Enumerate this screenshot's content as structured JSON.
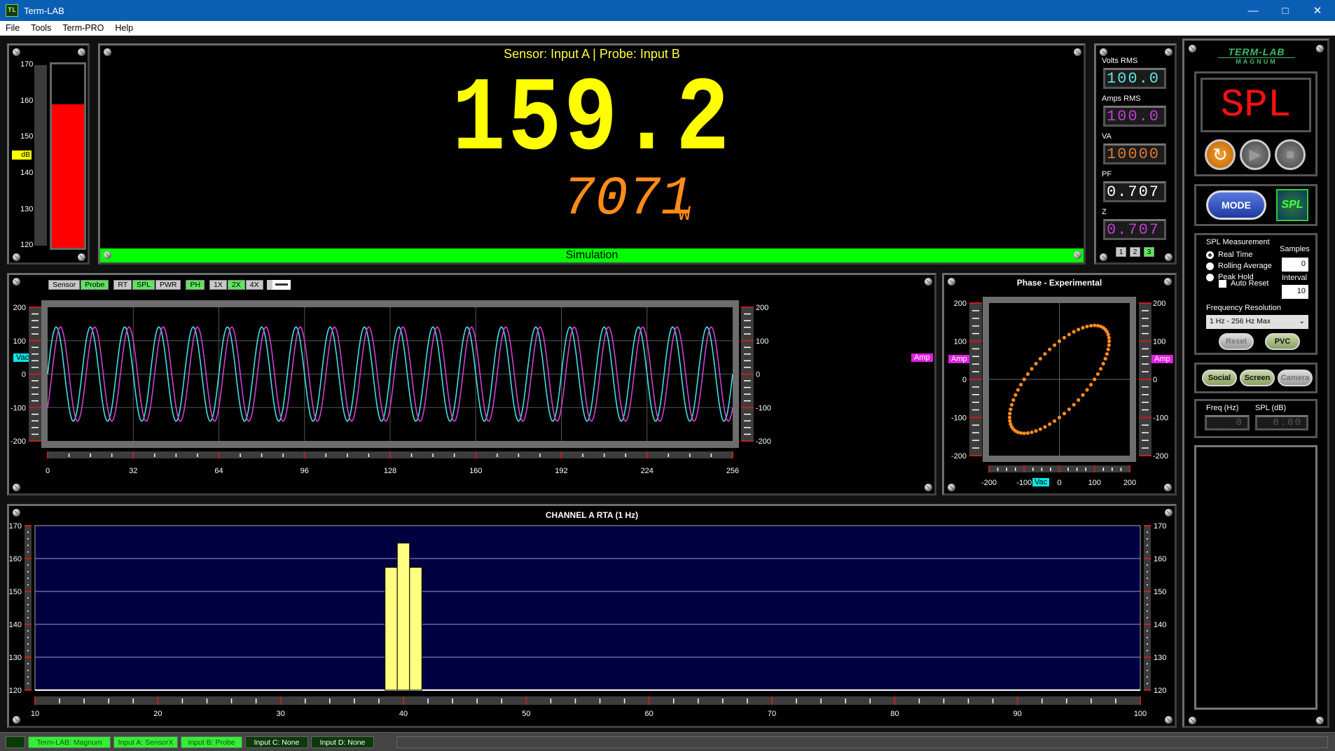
{
  "window": {
    "title": "Term-LAB",
    "icon_label": "TL",
    "minimize_icon": "minimize-icon",
    "maximize_icon": "maximize-icon",
    "close_icon": "close-icon"
  },
  "menu": [
    "File",
    "Tools",
    "Term-PRO",
    "Help"
  ],
  "spl_meter": {
    "unit_label": "dB",
    "scale_labels": [
      "170",
      "160",
      "150",
      "140",
      "130",
      "120"
    ],
    "range": [
      120,
      170
    ],
    "level": 159.2,
    "fill_color": "#ff0000"
  },
  "main_display": {
    "header": "Sensor: Input A | Probe: Input B",
    "primary_value": "159.2",
    "secondary_value": "7071",
    "secondary_unit": "W",
    "footer": "Simulation",
    "primary_color": "#ffff00",
    "secondary_color": "#ff8c1a",
    "footer_color": "#00ff00"
  },
  "readouts": {
    "items": [
      {
        "label": "Volts RMS",
        "value": "100.0",
        "color": "#5ee6e6"
      },
      {
        "label": "Amps RMS",
        "value": "100.0",
        "color": "#c040d0"
      },
      {
        "label": "VA",
        "value": "10000",
        "color": "#e07a30"
      },
      {
        "label": "PF",
        "value": "0.707",
        "color": "#ffffff"
      },
      {
        "label": "Z",
        "value": "0.707",
        "color": "#c040d0"
      }
    ],
    "pages": [
      "1",
      "2",
      "3"
    ],
    "active_page": "3"
  },
  "control_panel": {
    "logo_top": "TERM-LAB",
    "logo_bottom": "MAGNUM",
    "mode_display": "SPL",
    "transport": {
      "reset_icon": "refresh-icon",
      "play_icon": "play-icon",
      "stop_icon": "stop-icon"
    },
    "mode_button": "MODE",
    "mode_badge": "SPL",
    "spl_measurement": {
      "title": "SPL Measurement",
      "options": [
        "Real Time",
        "Rolling Average",
        "Peak Hold"
      ],
      "selected": "Real Time",
      "auto_reset_label": "Auto Reset",
      "auto_reset_checked": false,
      "samples_label": "Samples",
      "samples_value": "0",
      "interval_label": "Interval",
      "interval_value": "10",
      "freq_res_label": "Frequency Resolution",
      "freq_res_value": "1 Hz - 256 Hz Max",
      "reset_button": "Reset",
      "pvc_button": "PVC"
    },
    "share": {
      "social": "Social",
      "screen": "Screen",
      "camera": "Camera"
    },
    "cursor": {
      "freq_label": "Freq (Hz)",
      "freq_value": "0",
      "spl_label": "SPL (dB)",
      "spl_value": "0.00"
    }
  },
  "scope_toolbar": [
    "Sensor",
    "Probe",
    "RT",
    "SPL",
    "PWR",
    "PH",
    "1X",
    "2X",
    "4X"
  ],
  "scope_toolbar_active": [
    "Probe",
    "SPL",
    "PH",
    "2X"
  ],
  "status_bar": [
    {
      "label": "",
      "active": false
    },
    {
      "label": "Term-LAB: Magnum",
      "active": true
    },
    {
      "label": "Input A: SensorX",
      "active": true
    },
    {
      "label": "Input B: Probe",
      "active": true
    },
    {
      "label": "Input C: None",
      "active": false
    },
    {
      "label": "Input D: None",
      "active": false
    }
  ],
  "chart_data": [
    {
      "type": "line",
      "title": "",
      "xlabel": "",
      "ylabel_left": "Vac",
      "ylabel_right": "Amp",
      "x_range": [
        0,
        256
      ],
      "y_range": [
        -200,
        200
      ],
      "x_ticks": [
        "0",
        "32",
        "64",
        "96",
        "128",
        "160",
        "192",
        "224",
        "256"
      ],
      "y_ticks": [
        "200",
        "100",
        "0",
        "-100",
        "-200"
      ],
      "grid": true,
      "series": [
        {
          "name": "Vac",
          "color": "#40e0e0",
          "amplitude": 141.4,
          "cycles": 20,
          "phase_deg": 0
        },
        {
          "name": "Amp",
          "color": "#d040d0",
          "amplitude": 141.4,
          "cycles": 20,
          "phase_deg": -45
        }
      ]
    },
    {
      "type": "scatter",
      "title": "Phase - Experimental",
      "xlabel": "Vac",
      "ylabel": "Amp",
      "x_range": [
        -200,
        200
      ],
      "y_range": [
        -200,
        200
      ],
      "x_ticks": [
        "-200",
        "-100",
        "0",
        "100",
        "200"
      ],
      "y_ticks": [
        "200",
        "100",
        "0",
        "-100",
        "-200"
      ],
      "grid": true,
      "series": [
        {
          "name": "Lissajous",
          "color": "#ff8c1a",
          "amplitude_x": 141.4,
          "amplitude_y": 141.4,
          "phase_deg": 45,
          "points": 64
        }
      ]
    },
    {
      "type": "bar",
      "title": "CHANNEL A RTA (1 Hz)",
      "xlabel": "",
      "ylabel": "",
      "x_range": [
        10,
        100
      ],
      "y_range": [
        120,
        170
      ],
      "x_ticks": [
        "10",
        "20",
        "30",
        "40",
        "50",
        "60",
        "70",
        "80",
        "90",
        "100"
      ],
      "y_ticks": [
        "170",
        "160",
        "150",
        "140",
        "130",
        "120"
      ],
      "grid": true,
      "categories": [
        39,
        40,
        41
      ],
      "values": [
        157.3,
        164.7,
        157.3
      ],
      "bar_color": "#ffff80",
      "background": "#000040"
    }
  ]
}
